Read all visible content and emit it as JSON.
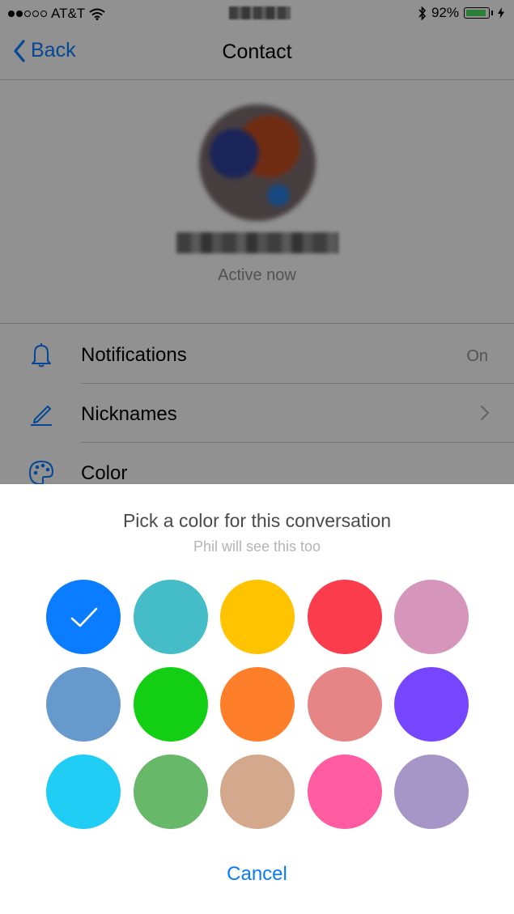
{
  "status_bar": {
    "carrier": "AT&T",
    "battery_percent": "92%",
    "battery_level": 0.92
  },
  "nav": {
    "back_label": "Back",
    "title": "Contact"
  },
  "profile": {
    "status": "Active now"
  },
  "settings": [
    {
      "label": "Notifications",
      "value": "On",
      "icon": "bell-icon"
    },
    {
      "label": "Nicknames",
      "icon": "pencil-icon"
    },
    {
      "label": "Color",
      "icon": "palette-icon"
    }
  ],
  "color_picker": {
    "title": "Pick a color for this conversation",
    "subtitle": "Phil will see this too",
    "colors": [
      "#0a7cff",
      "#45bdc8",
      "#ffc300",
      "#fa3c4c",
      "#d696bb",
      "#6699cc",
      "#13cf13",
      "#ff7e29",
      "#e68585",
      "#7646ff",
      "#20cef5",
      "#67b868",
      "#d4a88c",
      "#ff5ca1",
      "#a695c7"
    ],
    "selected_index": 0,
    "cancel_label": "Cancel"
  }
}
